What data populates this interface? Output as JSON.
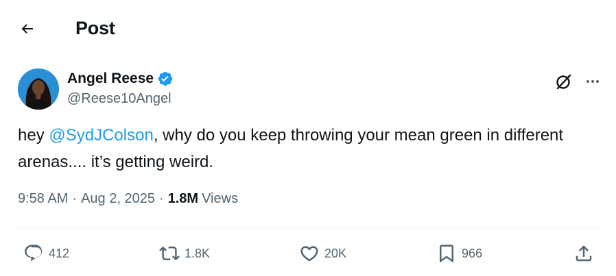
{
  "header": {
    "title": "Post"
  },
  "author": {
    "display_name": "Angel Reese",
    "handle": "@Reese10Angel",
    "verified": true
  },
  "tweet": {
    "text_prefix": "hey ",
    "mention": "@SydJColson",
    "text_suffix": ",  why do you keep throwing your mean green in different arenas.... it’s getting weird."
  },
  "meta": {
    "time": "9:58 AM",
    "separator": "·",
    "date": "Aug 2, 2025",
    "views_count": "1.8M",
    "views_label": "Views"
  },
  "actions": {
    "replies": "412",
    "reposts": "1.8K",
    "likes": "20K",
    "bookmarks": "966"
  },
  "colors": {
    "accent": "#1d9bf0",
    "text": "#0f1419",
    "secondary": "#536471",
    "divider": "#eff3f4"
  }
}
